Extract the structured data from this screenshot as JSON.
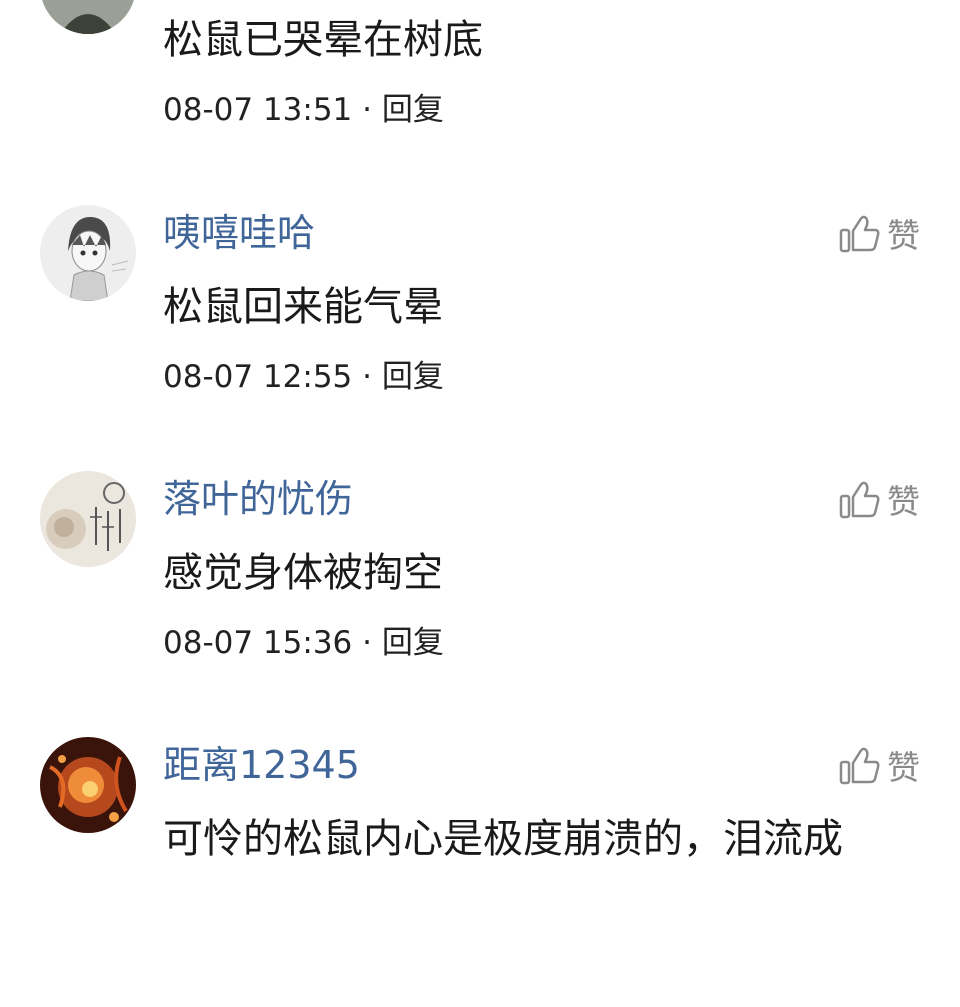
{
  "comments": [
    {
      "username": "",
      "content": "松鼠已哭晕在树底",
      "time": "08-07 13:51",
      "separator": "·",
      "reply": "回复",
      "avatar_icon": "user-avatar-icon"
    },
    {
      "username": "咦嘻哇哈",
      "content": "松鼠回来能气晕",
      "time": "08-07 12:55",
      "separator": "·",
      "reply": "回复",
      "like": "赞",
      "avatar_icon": "user-avatar-icon"
    },
    {
      "username": "落叶的忧伤",
      "content": "感觉身体被掏空",
      "time": "08-07 15:36",
      "separator": "·",
      "reply": "回复",
      "like": "赞",
      "avatar_icon": "user-avatar-icon"
    },
    {
      "username": "距离12345",
      "content": "可怜的松鼠内心是极度崩溃的，泪流成",
      "like": "赞",
      "avatar_icon": "user-avatar-icon"
    }
  ],
  "colors": {
    "username": "#406599",
    "content": "#1a1a1a",
    "meta": "#222222",
    "like": "#8a8a8a"
  },
  "icons": {
    "like": "thumbs-up-icon"
  }
}
